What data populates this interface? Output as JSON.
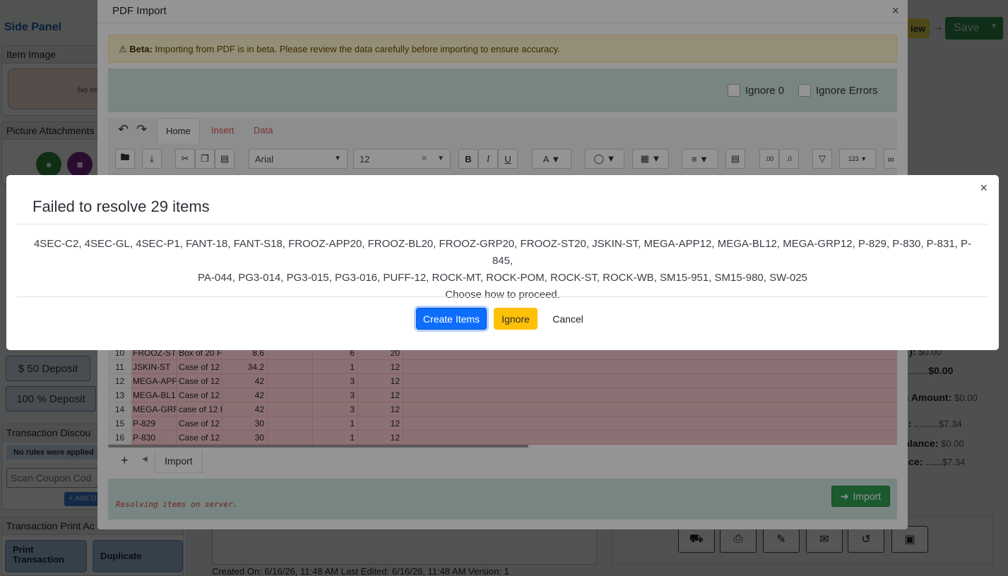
{
  "background": {
    "side_panel": {
      "title": "Side Panel",
      "item_image": "Item Image",
      "no_image": "No Im",
      "picture_attachments": "Picture Attachments",
      "deposit_50": "$ 50 Deposit",
      "deposit_100": "100 % Deposit",
      "transaction_discount": "Transaction Discou",
      "no_rules": "No rules were applied",
      "scan_coupon": "Scan Coupon Cod",
      "add_btn": "+ Add D",
      "transaction_print": "Transaction Print Ac",
      "print_transaction": "Print\nTransaction",
      "duplicate": "Duplicate"
    },
    "header": {
      "view_badge": "iew",
      "save_label": "Save"
    },
    "totals": [
      {
        "label": "pt ):",
        "value": "$0.00"
      },
      {
        "label": "):",
        "value": "$0.00"
      },
      {
        "label": "en Amount:",
        "value": "$0.00"
      },
      {
        "label": "ce:",
        "value": "$7.34"
      },
      {
        "label": "Balance:",
        "value": "$0.00"
      },
      {
        "label": "ance:",
        "value": "$7.34"
      }
    ],
    "created_line": "Created On: 6/16/26, 11:48 AM    Last Edited: 6/16/26, 11:48 AM    Version: 1"
  },
  "pdf_import": {
    "title": "PDF Import",
    "beta_label": "Beta:",
    "beta_text": "Importing from PDF is in beta. Please review the data carefully before importing to ensure accuracy.",
    "ignore_zero": "Ignore 0",
    "ignore_errors": "Ignore Errors",
    "tabs": [
      "Home",
      "Insert",
      "Data"
    ],
    "font_family": "Arial",
    "font_size": "12",
    "rows": [
      {
        "n": "10",
        "code": "FROOZ-ST",
        "desc": "Box of 20 F",
        "price": "8.6",
        "qty": "6",
        "pack": "20"
      },
      {
        "n": "11",
        "code": "JSKIN-ST",
        "desc": "Case of 12",
        "price": "34.2",
        "qty": "1",
        "pack": "12"
      },
      {
        "n": "12",
        "code": "MEGA-APF",
        "desc": "Case of 12",
        "price": "42",
        "qty": "3",
        "pack": "12"
      },
      {
        "n": "13",
        "code": "MEGA-BL1",
        "desc": "Case of 12",
        "price": "42",
        "qty": "3",
        "pack": "12"
      },
      {
        "n": "14",
        "code": "MEGA-GRF",
        "desc": "case of 12 E",
        "price": "42",
        "qty": "3",
        "pack": "12"
      },
      {
        "n": "15",
        "code": "P-829",
        "desc": "Case of 12",
        "price": "30",
        "qty": "1",
        "pack": "12"
      },
      {
        "n": "16",
        "code": "P-830",
        "desc": "Case of 12",
        "price": "30",
        "qty": "1",
        "pack": "12"
      }
    ],
    "sheet_tab": "Import",
    "status": "Resolving items on server.",
    "import_button": "Import"
  },
  "dialog": {
    "title": "Failed to resolve 29 items",
    "items_line1": "4SEC-C2, 4SEC-GL, 4SEC-P1, FANT-18, FANT-S18, FROOZ-APP20, FROOZ-BL20, FROOZ-GRP20, FROOZ-ST20, JSKIN-ST, MEGA-APP12, MEGA-BL12, MEGA-GRP12, P-829, P-830, P-831, P-845,",
    "items_line2": "PA-044, PG3-014, PG3-015, PG3-016, PUFF-12, ROCK-MT, ROCK-POM, ROCK-ST, ROCK-WB, SM15-951, SM15-980, SW-025",
    "prompt": "Choose how to proceed.",
    "create_button": "Create Items",
    "ignore_button": "Ignore",
    "cancel_button": "Cancel"
  }
}
